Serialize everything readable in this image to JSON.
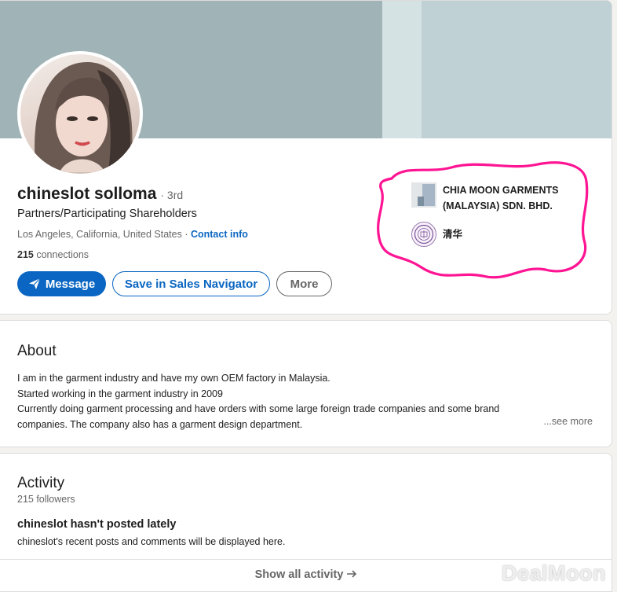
{
  "profile": {
    "name": "chineslot solloma",
    "degree": "· 3rd",
    "headline": "Partners/Participating Shareholders",
    "location": "Los Angeles, California, United States",
    "separator": " · ",
    "contact_label": "Contact info",
    "connections_count": "215",
    "connections_label": " connections",
    "buttons": {
      "message": "Message",
      "sales_navigator": "Save in Sales Navigator",
      "more": "More"
    },
    "company": "CHIA MOON GARMENTS (MALAYSIA) SDN. BHD.",
    "school": "清华",
    "highlight_color": "#ff1493"
  },
  "about": {
    "title": "About",
    "lines": [
      "I am in the garment industry and have my own OEM factory in Malaysia.",
      "Started working in the garment industry in 2009",
      "Currently doing garment processing and have orders with some large foreign trade companies and some brand",
      "companies. The company also has a garment design department."
    ],
    "see_more": "...see more"
  },
  "activity": {
    "title": "Activity",
    "followers": "215 followers",
    "empty_title": "chineslot hasn't posted lately",
    "empty_subtitle": "chineslot's recent posts and comments will be displayed here.",
    "show_all": "Show all activity"
  },
  "watermark": "DealMoon",
  "colors": {
    "brand_blue": "#0a66c2",
    "banner": "#a0b3b6",
    "page_background": "#f3f2ef"
  }
}
